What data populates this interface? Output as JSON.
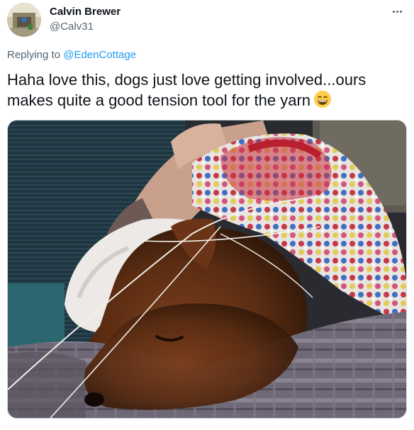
{
  "author": {
    "name": "Calvin Brewer",
    "handle": "@Calv31",
    "avatar_icon": "profile-photo"
  },
  "reply": {
    "prefix": "Replying to",
    "mention": "@EdenCottage"
  },
  "tweet": {
    "text": "Haha love this, dogs just love getting involved...ours makes quite a good tension tool for the yarn",
    "emoji": "grinning-face-with-smiling-eyes"
  },
  "colors": {
    "link": "#1d9bf0",
    "secondary_text": "#536471",
    "primary_text": "#0f1419"
  },
  "menu": {
    "icon": "more-options-icon"
  },
  "media": {
    "type": "photo",
    "subject": "dog resting head on lap with crochet yarn"
  }
}
